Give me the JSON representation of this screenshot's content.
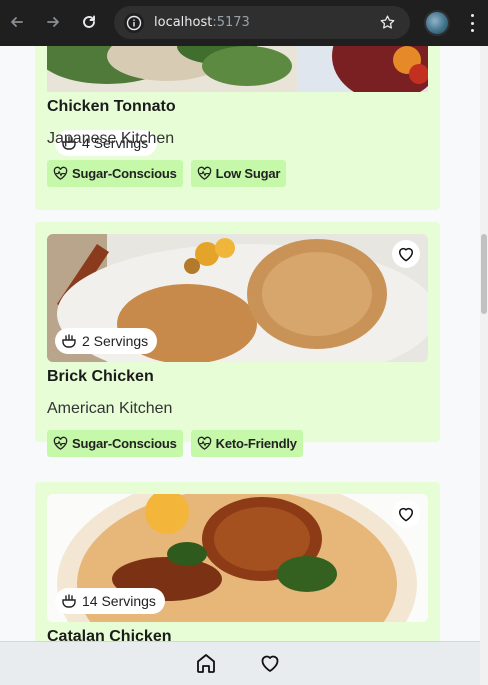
{
  "browser": {
    "url_host": "localhost",
    "url_port": ":5173"
  },
  "recipes": [
    {
      "servings": "4 Servings",
      "title": "Chicken Tonnato",
      "cuisine": "Japanese Kitchen",
      "tags": [
        "Sugar-Conscious",
        "Low Sugar"
      ]
    },
    {
      "servings": "2 Servings",
      "title": "Brick Chicken",
      "cuisine": "American Kitchen",
      "tags": [
        "Sugar-Conscious",
        "Keto-Friendly"
      ]
    },
    {
      "servings": "14 Servings",
      "title": "Catalan Chicken",
      "cuisine": "",
      "tags": []
    }
  ],
  "colors": {
    "card_bg": "#e6fdd6",
    "tag_bg": "#c5f8a8",
    "browser_bar": "#1f1f1f",
    "bottom_nav": "#e9ecef"
  },
  "icons": {
    "servings": "pot-icon",
    "tag": "heart-pulse-icon",
    "favorite": "heart-outline-icon",
    "home": "home-icon",
    "favorites_nav": "heart-outline-icon"
  }
}
